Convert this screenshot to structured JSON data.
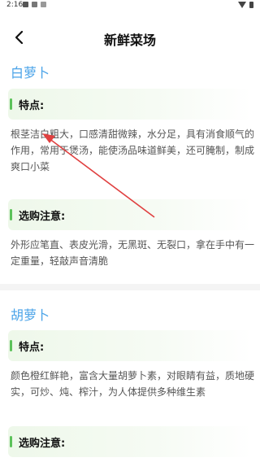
{
  "status_bar": {
    "time": "2:16"
  },
  "header": {
    "title": "新鲜菜场"
  },
  "items": [
    {
      "name": "白萝卜",
      "features_label": "特点:",
      "features_text": "根茎洁白粗大，口感清甜微辣，水分足，具有消食顺气的作用，常用于煲汤，能使汤品味道鲜美，还可腌制，制成爽口小菜",
      "tips_label": "选购注意:",
      "tips_text": "外形应笔直、表皮光滑，无黑斑、无裂口，拿在手中有一定重量，轻敲声音清脆"
    },
    {
      "name": "胡萝卜",
      "features_label": "特点:",
      "features_text": "颜色橙红鲜艳，富含大量胡萝卜素，对眼睛有益，质地硬实，可炒、炖、榨汁，为人体提供多种维生素",
      "tips_label": "选购注意:"
    }
  ],
  "colors": {
    "accent_blue": "#4aa3e8",
    "accent_green": "#5cc25a",
    "arrow_red": "#e04040"
  },
  "icons": {
    "back": "chevron-left-icon"
  }
}
